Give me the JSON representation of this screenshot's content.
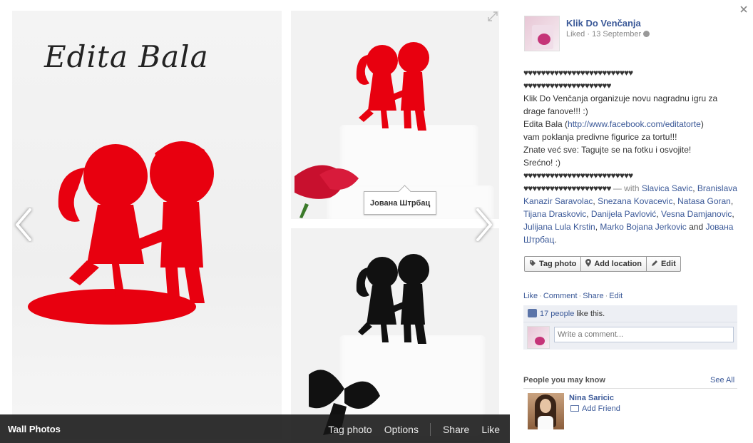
{
  "photo": {
    "signature": "Edita Bala",
    "tag_tooltip": "Јована Штрбац",
    "album_name": "Wall Photos",
    "actions": [
      "Tag photo",
      "Options",
      "Share",
      "Like"
    ],
    "nav_prev_icon": "chevron-left-icon",
    "nav_next_icon": "chevron-right-icon",
    "expand_icon": "expand-icon"
  },
  "side": {
    "close_icon": "close-icon",
    "page_name": "Klik Do Venčanja",
    "meta": "Liked · 13 September",
    "post": {
      "hearts1": "♥♥♥♥♥♥♥♥♥♥♥♥♥♥♥♥♥♥♥♥♥♥♥♥♥",
      "hearts2": "♥♥♥♥♥♥♥♥♥♥♥♥♥♥♥♥♥♥♥♥",
      "line1": "Klik Do Venčanja organizuje novu nagradnu igru za drage fanove!!! :)",
      "line2_pre": "Edita Bala (",
      "line2_link": "http://www.facebook.com/editatorte",
      "line2_post": ")",
      "line3": "vam poklanja predivne figurice za tortu!!!",
      "line4": "Znate već sve: Tagujte se na fotku i osvojite!",
      "line5": "Srećno! :)",
      "hearts3": "♥♥♥♥♥♥♥♥♥♥♥♥♥♥♥♥♥♥♥♥♥♥♥♥♥",
      "hearts4": "♥♥♥♥♥♥♥♥♥♥♥♥♥♥♥♥♥♥♥♥",
      "with_label": " — with ",
      "tagged": [
        "Slavica Savic",
        "Branislava Kanazir Saravolac",
        "Snezana Kovacevic",
        "Natasa Goran",
        "Tijana Draskovic",
        "Danijela Pavlović",
        "Vesna Damjanovic",
        "Julijana Lula Krstin",
        "Marko Bojana Jerkovic"
      ],
      "and_label": " and ",
      "last_tagged": "Јована Штрбац",
      "end": "."
    },
    "buttons": {
      "tag": "Tag photo",
      "location": "Add location",
      "edit": "Edit"
    },
    "action_links": [
      "Like",
      "Comment",
      "Share",
      "Edit"
    ],
    "likes_count": "17 people",
    "likes_suffix": " like this.",
    "comment_placeholder": "Write a comment...",
    "pymk": {
      "heading": "People you may know",
      "see_all": "See All",
      "person_name": "Nina Saricic",
      "add_friend": "Add Friend"
    }
  },
  "colors": {
    "link": "#3b5998",
    "figure_red": "#e8000f",
    "figure_black": "#111111"
  }
}
